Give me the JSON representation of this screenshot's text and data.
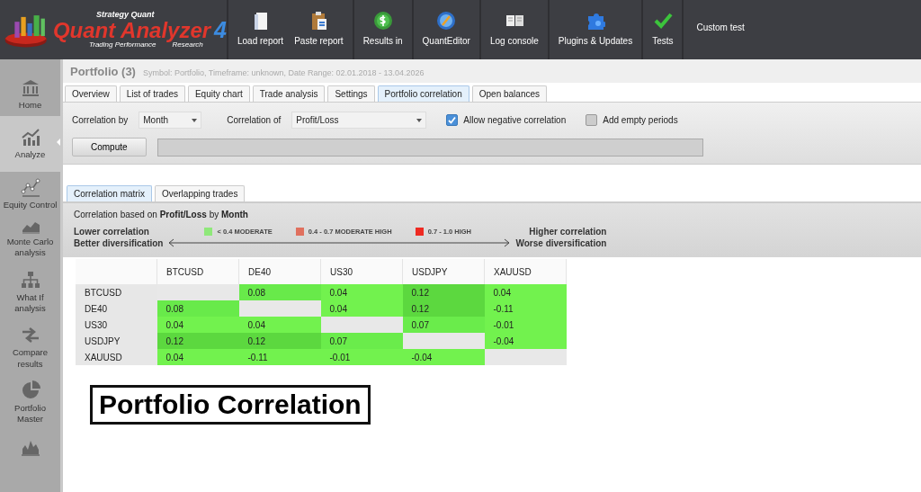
{
  "header": {
    "logo": {
      "brand": "Strategy Quant",
      "product": "Quant Analyzer",
      "version": "4",
      "tagline_left": "Trading Performance",
      "tagline_right": "Research"
    },
    "toolbar": [
      {
        "buttons": [
          {
            "label": "Load report",
            "kind": "file"
          },
          {
            "label": "Paste report",
            "kind": "clipboard"
          }
        ]
      },
      {
        "buttons": [
          {
            "label": "Results in",
            "kind": "dollar"
          }
        ]
      },
      {
        "buttons": [
          {
            "label": "QuantEditor",
            "kind": "globe"
          }
        ]
      },
      {
        "buttons": [
          {
            "label": "Log console",
            "kind": "book"
          }
        ]
      },
      {
        "buttons": [
          {
            "label": "Plugins & Updates",
            "kind": "puzzle"
          }
        ]
      },
      {
        "buttons": [
          {
            "label": "Tests",
            "kind": "check"
          }
        ]
      },
      {
        "buttons": [
          {
            "label": "Custom test",
            "kind": "text"
          }
        ]
      }
    ]
  },
  "sidebar": {
    "items": [
      {
        "label": "Home",
        "kind": "bank",
        "selected": false
      },
      {
        "label": "Analyze",
        "kind": "growth",
        "selected": true
      },
      {
        "label": "Equity Control",
        "kind": "line",
        "selected": false
      },
      {
        "label": "Monte Carlo analysis",
        "kind": "area",
        "selected": false
      },
      {
        "label": "What If analysis",
        "kind": "tree",
        "selected": false
      },
      {
        "label": "Compare results",
        "kind": "arrows",
        "selected": false
      },
      {
        "label": "Portfolio Master",
        "kind": "pie",
        "selected": false
      },
      {
        "kind": "hist",
        "selected": false
      }
    ]
  },
  "page": {
    "title": "Portfolio (3)",
    "subtitle": "Symbol: Portfolio, Timeframe: unknown, Date Range: 02.01.2018 - 13.04.2026"
  },
  "tabs": [
    {
      "label": "Overview",
      "selected": false
    },
    {
      "label": "List of trades",
      "selected": false
    },
    {
      "label": "Equity chart",
      "selected": false
    },
    {
      "label": "Trade analysis",
      "selected": false
    },
    {
      "label": "Settings",
      "selected": false
    },
    {
      "label": "Portfolio correlation",
      "selected": true
    },
    {
      "label": "Open balances",
      "selected": false
    }
  ],
  "controls": {
    "correlation_by": {
      "label": "Correlation by",
      "value": "Month"
    },
    "correlation_of": {
      "label": "Correlation of",
      "value": "Profit/Loss"
    },
    "checkboxes": [
      {
        "label": "Allow negative correlation",
        "checked": true
      },
      {
        "label": "Add empty periods",
        "checked": false
      }
    ],
    "compute_button": "Compute"
  },
  "subtabs": [
    {
      "label": "Correlation matrix",
      "selected": true
    },
    {
      "label": "Overlapping trades",
      "selected": false
    }
  ],
  "info": {
    "description": "Correlation based on **Profit/Loss** by **Month**",
    "left_hint": [
      "Lower correlation",
      "Better diversification"
    ],
    "right_hint": [
      "Higher correlation",
      "Worse diversification"
    ],
    "legend": [
      {
        "label": "< 0.4 MODERATE",
        "color": "#8fe87a"
      },
      {
        "label": "0.4 - 0.7 MODERATE HIGH",
        "color": "#e0705e"
      },
      {
        "label": "0.7 - 1.0 HIGH",
        "color": "#ee2a22"
      }
    ]
  },
  "matrix": {
    "columns": [
      "BTCUSD",
      "DE40",
      "US30",
      "USDJPY",
      "XAUUSD"
    ],
    "rows": [
      {
        "label": "BTCUSD",
        "cells": [
          {
            "kind": "diagonal"
          },
          {
            "kind": "value",
            "value": "0.08",
            "color": "#68ea4a"
          },
          {
            "kind": "value",
            "value": "0.04",
            "color": "#72f24e"
          },
          {
            "kind": "value",
            "value": "0.12",
            "color": "#5cd83f"
          },
          {
            "kind": "value",
            "value": "0.04",
            "color": "#72f24e"
          }
        ]
      },
      {
        "label": "DE40",
        "cells": [
          {
            "kind": "value",
            "value": "0.08",
            "color": "#68ea4a"
          },
          {
            "kind": "diagonal"
          },
          {
            "kind": "value",
            "value": "0.04",
            "color": "#72f24e"
          },
          {
            "kind": "value",
            "value": "0.12",
            "color": "#5cd83f"
          },
          {
            "kind": "value",
            "value": "-0.11",
            "color": "#72f24e"
          }
        ]
      },
      {
        "label": "US30",
        "cells": [
          {
            "kind": "value",
            "value": "0.04",
            "color": "#72f24e"
          },
          {
            "kind": "value",
            "value": "0.04",
            "color": "#72f24e"
          },
          {
            "kind": "diagonal"
          },
          {
            "kind": "value",
            "value": "0.07",
            "color": "#6aec4b"
          },
          {
            "kind": "value",
            "value": "-0.01",
            "color": "#72f24e"
          }
        ]
      },
      {
        "label": "USDJPY",
        "cells": [
          {
            "kind": "value",
            "value": "0.12",
            "color": "#5cd83f"
          },
          {
            "kind": "value",
            "value": "0.12",
            "color": "#5cd83f"
          },
          {
            "kind": "value",
            "value": "0.07",
            "color": "#6aec4b"
          },
          {
            "kind": "diagonal"
          },
          {
            "kind": "value",
            "value": "-0.04",
            "color": "#72f24e"
          }
        ]
      },
      {
        "label": "XAUUSD",
        "cells": [
          {
            "kind": "value",
            "value": "0.04",
            "color": "#72f24e"
          },
          {
            "kind": "value",
            "value": "-0.11",
            "color": "#72f24e"
          },
          {
            "kind": "value",
            "value": "-0.01",
            "color": "#72f24e"
          },
          {
            "kind": "value",
            "value": "-0.04",
            "color": "#72f24e"
          },
          {
            "kind": "diagonal"
          }
        ]
      }
    ]
  },
  "overlay_title": "Portfolio Correlation"
}
